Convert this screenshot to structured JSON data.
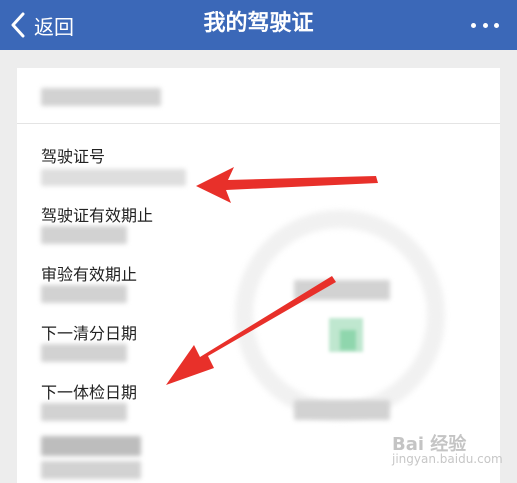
{
  "header": {
    "back_label": "返回",
    "title": "我的驾驶证",
    "bg_color": "#3b68b8"
  },
  "card": {
    "fields": [
      {
        "label": "驾驶证号"
      },
      {
        "label": "驾驶证有效期止"
      },
      {
        "label": "审验有效期止"
      },
      {
        "label": "下一清分日期"
      },
      {
        "label": "下一体检日期"
      }
    ]
  },
  "annotations": {
    "arrow_color": "#e8302a"
  },
  "watermark": {
    "line1": "Bai 经验",
    "line2": "jingyan.baidu.com"
  }
}
